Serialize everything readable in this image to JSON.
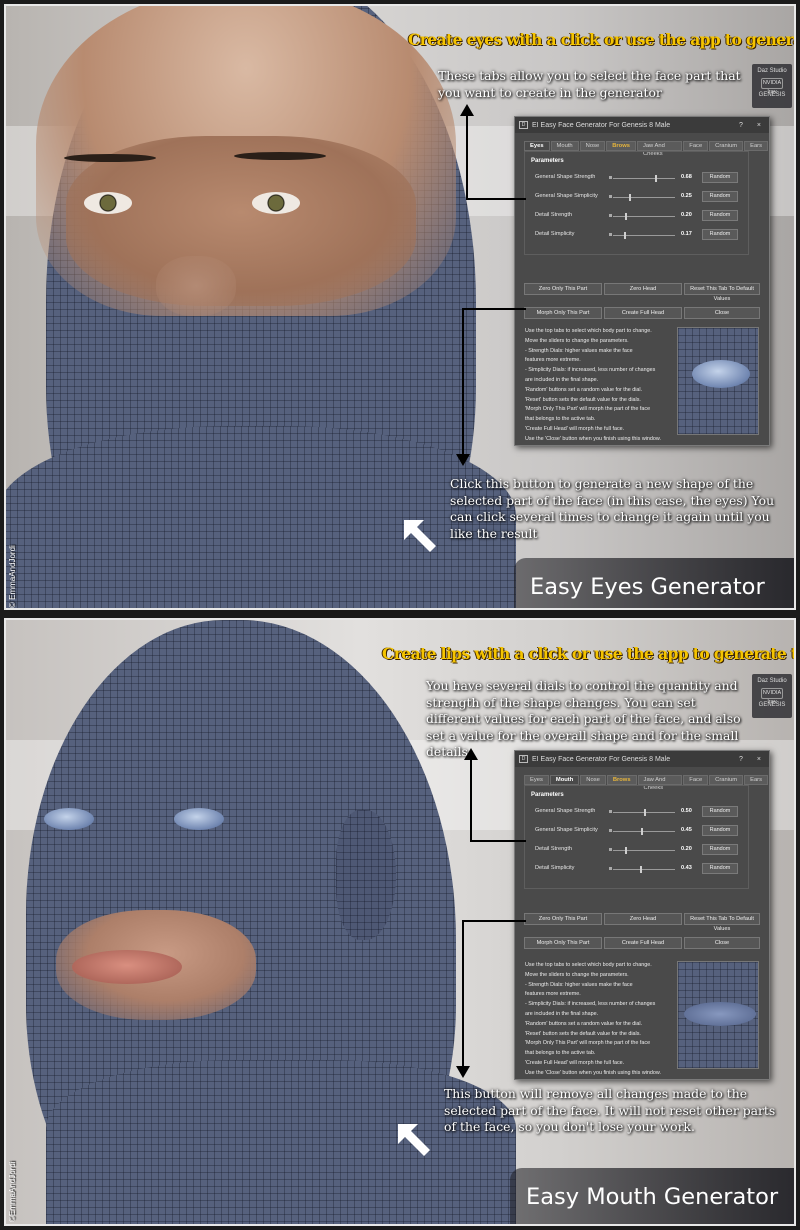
{
  "panels": [
    {
      "top_title": "Create eyes with a click or use the app to generate them with custom settings",
      "tabs_note": "These tabs allow you to select the face part that you want to create in the generator",
      "button_note": "Click this button to generate a new shape of the selected part of the face (in this case, the eyes) You can click several times to change it again until you like the result",
      "banner": "Easy Eyes Generator",
      "credit": "© EmmaAndJordi",
      "active_tab": "Eyes",
      "sliders": [
        {
          "label": "General Shape Strength",
          "value": "0.68",
          "level": 0.68,
          "random": "Random"
        },
        {
          "label": "General Shape Simplicity",
          "value": "0.25",
          "level": 0.25,
          "random": "Random"
        },
        {
          "label": "Detail Strength",
          "value": "0.20",
          "level": 0.2,
          "random": "Random"
        },
        {
          "label": "Detail Simplicity",
          "value": "0.17",
          "level": 0.17,
          "random": "Random"
        }
      ]
    },
    {
      "top_title": "Create lips with a click or use the app to generate them with custom settings",
      "tabs_note": "You have several dials to control the quantity and strength of the shape changes. You can set different values for each part of the face, and also set a value for the overall shape and for the small details",
      "button_note": "This button will remove all changes made to the selected part of the face. It will not reset other parts of the face, so you don't lose your work.",
      "banner": "Easy Mouth Generator",
      "credit": "©EmmaAndJordi",
      "active_tab": "Mouth",
      "sliders": [
        {
          "label": "General Shape Strength",
          "value": "0.50",
          "level": 0.5,
          "random": "Random"
        },
        {
          "label": "General Shape Simplicity",
          "value": "0.45",
          "level": 0.45,
          "random": "Random"
        },
        {
          "label": "Detail Strength",
          "value": "0.20",
          "level": 0.2,
          "random": "Random"
        },
        {
          "label": "Detail Simplicity",
          "value": "0.43",
          "level": 0.43,
          "random": "Random"
        }
      ]
    }
  ],
  "dialog": {
    "title": "EI Easy Face Generator For Genesis 8 Male",
    "help_glyph": "?",
    "close_glyph": "×",
    "tabs": [
      "Eyes",
      "Mouth",
      "Nose",
      "Brows",
      "Jaw And Cheeks",
      "Face",
      "Cranium",
      "Ears"
    ],
    "params_label": "Parameters",
    "buttons_row1": [
      "Zero Only This Part",
      "Zero Head",
      "Reset This Tab To Default Values"
    ],
    "buttons_row2": [
      "Morph Only This Part",
      "Create Full Head",
      "Close"
    ],
    "help_lines": [
      "Use the top tabs to select which body part to change.",
      "Move the sliders to change the parameters.",
      "- Strength Dials: higher values make the face",
      "features more extreme.",
      "- Simplicity Dials: if increased, less number of changes",
      "are included in the final shape.",
      "'Random' buttons set a random value for the dial.",
      "'Reset' button sets the default value for the dials.",
      "'Morph Only This Part' will morph the part of the face",
      "that belongs to the active tab.",
      "'Create Full Head' will morph the full face.",
      "Use the 'Close' button when you finish using this window."
    ]
  },
  "logo": {
    "line1": "Daz Studio",
    "line2": "NVIDIA Iray",
    "line3": "GENESIS"
  },
  "colors": {
    "title_yellow": "#f5c400",
    "mesh_blue": "#56617d",
    "dialog_gray": "#4a4a4a",
    "brows_tab": "#e7b53b"
  }
}
